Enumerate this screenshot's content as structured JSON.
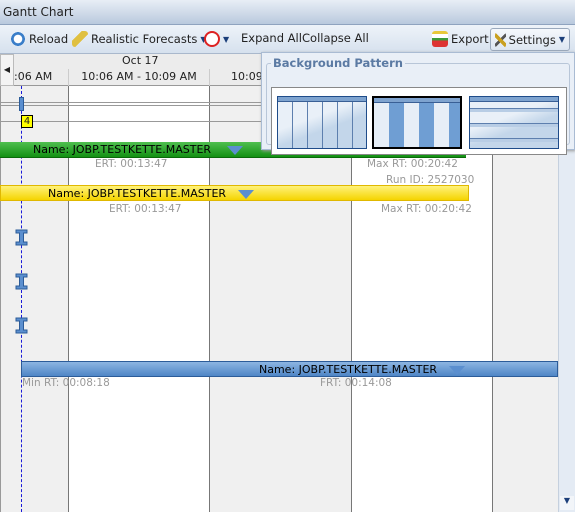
{
  "window": {
    "title": "Gantt Chart"
  },
  "toolbar": {
    "reload": "Reload",
    "realistic_forecasts": "Realistic Forecasts",
    "expand_all": "Expand All",
    "collapse_all": "Collapse All",
    "export": "Export",
    "settings": "Settings"
  },
  "timeline": {
    "date": "Oct 17",
    "columns": [
      ":06 AM",
      "10:06 AM - 10:09 AM",
      "10:09"
    ]
  },
  "marker": {
    "count": "4"
  },
  "bars": [
    {
      "name": "Name: JOBP.TESTKETTE.MASTER",
      "color": "#1e9a1e",
      "ert": "ERT: 00:13:47",
      "max_rt": "Max RT: 00:20:42"
    },
    {
      "name": "Name: JOBP.TESTKETTE.MASTER",
      "color": "#f5d400",
      "run_id": "Run ID: 2527030",
      "ert": "ERT: 00:13:47",
      "max_rt": "Max RT: 00:20:42"
    },
    {
      "name": "Name: JOBP.TESTKETTE.MASTER",
      "color": "#5b8fcf",
      "min_rt": "Min RT: 00:08:18",
      "frt": "FRT: 00:14:08"
    }
  ],
  "settings_popup": {
    "title": "Background Pattern",
    "options": [
      "vertical-lines",
      "vertical-stripes",
      "horizontal-lines"
    ],
    "selected": "vertical-stripes"
  }
}
